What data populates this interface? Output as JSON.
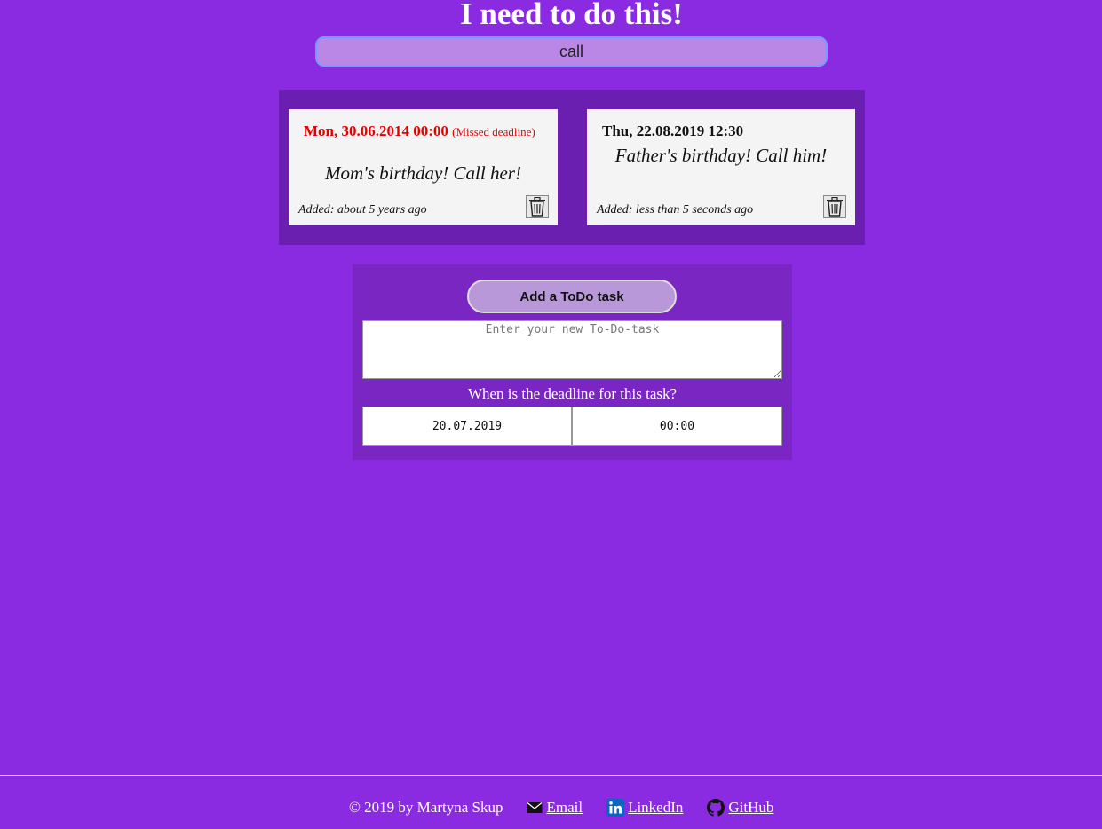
{
  "header": {
    "title": "I need to do this!"
  },
  "search": {
    "value": "call"
  },
  "tasks": [
    {
      "deadline": "Mon, 30.06.2014 00:00",
      "deadline_note": "(Missed deadline)",
      "text": "Mom's birthday! Call her!",
      "added": "Added: about 5 years ago",
      "missed": true
    },
    {
      "deadline": "Thu, 22.08.2019 12:30",
      "deadline_note": "",
      "text": "Father's birthday! Call him!",
      "added": "Added: less than 5 seconds ago",
      "missed": false
    }
  ],
  "add_form": {
    "button_label": "Add a ToDo task",
    "task_placeholder": "Enter your new To-Do-task",
    "deadline_label": "When is the deadline for this task?",
    "date_value": "20.07.2019",
    "time_value": "00:00"
  },
  "footer": {
    "copyright": "© 2019 by Martyna Skup",
    "links": [
      {
        "label": "Email",
        "icon": "envelope-icon"
      },
      {
        "label": "LinkedIn",
        "icon": "linkedin-icon"
      },
      {
        "label": "GitHub",
        "icon": "github-icon"
      }
    ]
  },
  "colors": {
    "background": "#8a2be2",
    "tasks_panel": "#6a1fb0",
    "form_panel": "#7a26c2",
    "missed_deadline": "#e60000",
    "linkedin": "#0a66c2"
  }
}
